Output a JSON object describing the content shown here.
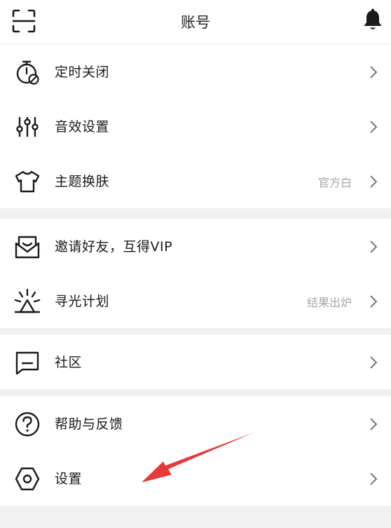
{
  "header": {
    "title": "账号",
    "scan_icon": "scan-icon",
    "bell_icon": "bell-icon"
  },
  "groups": [
    {
      "items": [
        {
          "label": "定时关闭",
          "value": "",
          "icon": "timer-off-icon"
        },
        {
          "label": "音效设置",
          "value": "",
          "icon": "equalizer-icon"
        },
        {
          "label": "主题换肤",
          "value": "官方白",
          "icon": "tshirt-icon"
        }
      ]
    },
    {
      "items": [
        {
          "label": "邀请好友，互得VIP",
          "value": "",
          "icon": "envelope-invite-icon"
        },
        {
          "label": "寻光计划",
          "value": "结果出炉",
          "icon": "light-beam-icon"
        }
      ]
    },
    {
      "items": [
        {
          "label": "社区",
          "value": "",
          "icon": "chat-bubble-icon"
        }
      ]
    },
    {
      "items": [
        {
          "label": "帮助与反馈",
          "value": "",
          "icon": "help-circle-icon"
        },
        {
          "label": "设置",
          "value": "",
          "icon": "settings-hexagon-icon"
        }
      ]
    }
  ],
  "annotation": {
    "color": "#e8383a"
  }
}
